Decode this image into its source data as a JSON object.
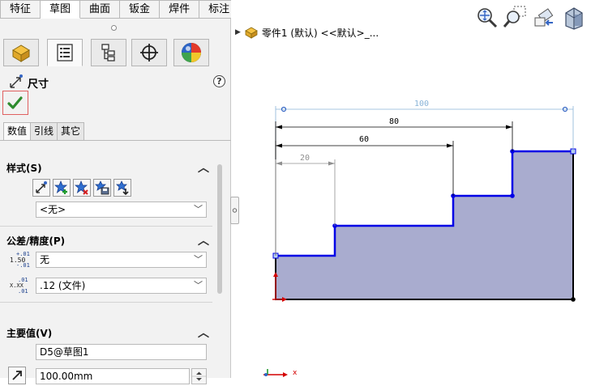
{
  "menu_tabs": [
    "特征",
    "草图",
    "曲面",
    "钣金",
    "焊件",
    "标注"
  ],
  "active_menu_tab": "草图",
  "property_manager": {
    "icon_tabs": [
      "feature-manager-icon",
      "property-manager-icon",
      "configuration-manager-icon",
      "dimxpert-icon",
      "appearance-icon"
    ],
    "title": "尺寸",
    "help_label": "?",
    "sub_tabs": [
      "数值",
      "引线",
      "其它"
    ],
    "active_sub_tab": "数值"
  },
  "style_group": {
    "title": "样式(S)",
    "style_buttons": [
      "apply-default-icon",
      "add-style-icon",
      "delete-style-icon",
      "save-style-icon",
      "load-style-icon"
    ],
    "style_value": "<无>"
  },
  "tolerance_group": {
    "title": "公差/精度(P)",
    "tolerance_icon_text": [
      "+.01",
      "1.50",
      "-.01"
    ],
    "tolerance_value": "无",
    "precision_icon_text": [
      ".01",
      "X.XX",
      ".01"
    ],
    "precision_value": ".12 (文件)"
  },
  "primary_value_group": {
    "title": "主要值(V)",
    "name_value": "D5@草图1",
    "dimension_value": "100.00mm"
  },
  "feature_tree": {
    "node_label": "零件1 (默认) <<默认>_..."
  },
  "view_toolbar": [
    "zoom-to-fit-icon",
    "zoom-to-area-icon",
    "previous-view-icon",
    "section-view-icon"
  ],
  "sketch": {
    "dimensions": [
      "100",
      "80",
      "60",
      "20"
    ],
    "triad_x_label": "x",
    "colors": {
      "fill": "#a9accf",
      "selected_line": "#0000e6",
      "fixed_line": "#000000",
      "dim_line": "#000000",
      "preview_dim": "#8ab4d8",
      "origin": "#d40000",
      "accent_ok": "#2e8b2e"
    }
  }
}
